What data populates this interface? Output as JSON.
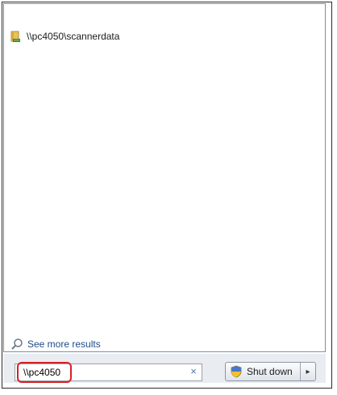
{
  "results": {
    "items": [
      {
        "label": "\\\\pc4050\\scannerdata",
        "icon": "folder-icon"
      }
    ]
  },
  "see_more": {
    "label": "See more results",
    "icon": "search-icon"
  },
  "search": {
    "value": "\\\\pc4050",
    "clear_icon": "×"
  },
  "shutdown": {
    "label": "Shut down",
    "icon": "shield-icon",
    "arrow_icon": "▸"
  },
  "colors": {
    "link": "#1e4a8a",
    "highlight": "#d62027",
    "bar": "#e9ecf1"
  }
}
